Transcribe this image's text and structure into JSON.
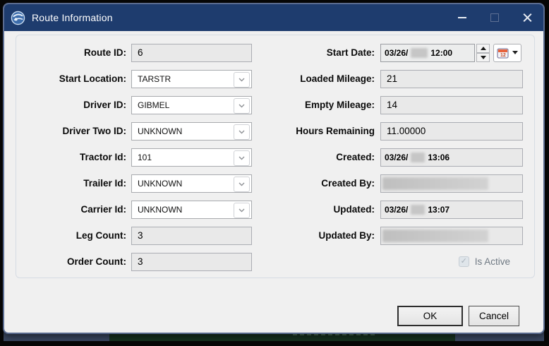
{
  "titlebar": {
    "title": "Route Information",
    "icons": [
      "app-logo-icon",
      "minimize-icon",
      "maximize-icon-disabled",
      "close-icon"
    ],
    "color": "#1e3c6e"
  },
  "fields_left": [
    {
      "label": "Route ID:",
      "value": "6",
      "control": "textbox"
    },
    {
      "label": "Start Location:",
      "value": "TARSTR",
      "control": "combobox"
    },
    {
      "label": "Driver ID:",
      "value": "GIBMEL",
      "control": "combobox"
    },
    {
      "label": "Driver Two ID:",
      "value": "UNKNOWN",
      "control": "combobox"
    },
    {
      "label": "Tractor Id:",
      "value": "101",
      "control": "combobox"
    },
    {
      "label": "Trailer Id:",
      "value": "UNKNOWN",
      "control": "combobox"
    },
    {
      "label": "Carrier Id:",
      "value": "UNKNOWN",
      "control": "combobox"
    },
    {
      "label": "Leg Count:",
      "value": "3",
      "control": "textbox"
    },
    {
      "label": "Order Count:",
      "value": "3",
      "control": "textbox"
    }
  ],
  "fields_right": {
    "start_date": {
      "label": "Start Date:",
      "date": "03/26/",
      "time": "12:00",
      "year_redacted": true
    },
    "loaded_mileage": {
      "label": "Loaded Mileage:",
      "value": "21"
    },
    "empty_mileage": {
      "label": "Empty Mileage:",
      "value": "14"
    },
    "hours_remaining": {
      "label": "Hours Remaining",
      "value": "11.00000"
    },
    "created": {
      "label": "Created:",
      "date": "03/26/",
      "time": "13:06",
      "year_redacted": true
    },
    "created_by": {
      "label": "Created By:",
      "value_redacted": true
    },
    "updated": {
      "label": "Updated:",
      "date": "03/26/",
      "time": "13:07",
      "year_redacted": true
    },
    "updated_by": {
      "label": "Updated By:",
      "value_redacted": true
    },
    "is_active": {
      "label": "Is Active",
      "checked": true,
      "enabled": false,
      "checkmark": "✓"
    }
  },
  "buttons": {
    "ok": "OK",
    "cancel": "Cancel"
  },
  "colors": {
    "dialog_background": "#f0f0f0",
    "field_background": "#e9e9e9",
    "dialog_border": "#5b6c90",
    "groupbox_border": "#d6dce3"
  }
}
